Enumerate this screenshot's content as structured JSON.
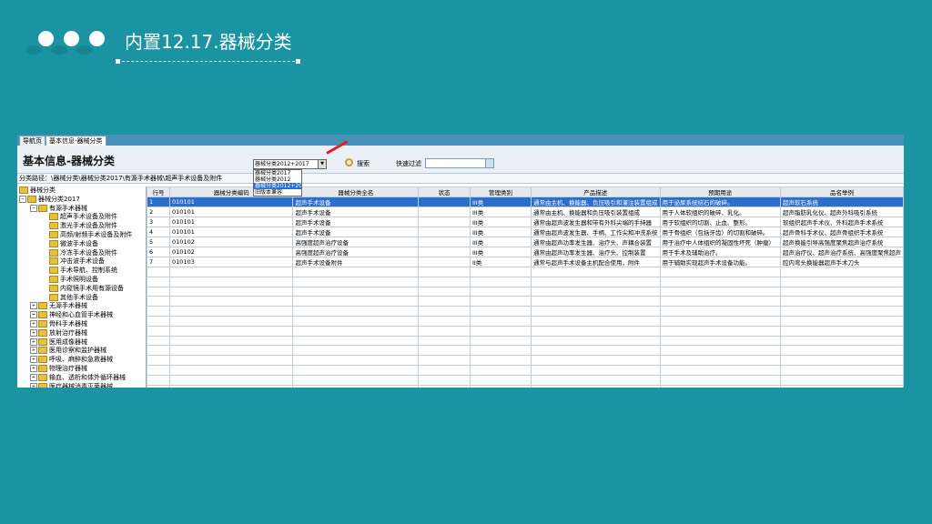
{
  "slide": {
    "title": "内置12.17.器械分类"
  },
  "app": {
    "tabs": [
      "导航页",
      "基本信息-器械分类"
    ],
    "header_title": "基本信息-器械分类",
    "select_value": "器械分类2012+2017",
    "dropdown_options": [
      "器械分类2017",
      "器械分类2012",
      "器械分类2012+2017",
      "旧版本兼容"
    ],
    "search_label": "搜索",
    "filter_label": "快速过滤",
    "path": "分类路径：\\器械分类\\器械分类2017\\有源手术器械\\超声手术设备及附件",
    "tree": [
      {
        "label": "器械分类",
        "level": 0,
        "exp": ""
      },
      {
        "label": "器械分类2017",
        "level": 0,
        "exp": "−"
      },
      {
        "label": "有源手术器械",
        "level": 1,
        "exp": "−"
      },
      {
        "label": "超声手术设备及附件",
        "level": 2,
        "exp": ""
      },
      {
        "label": "激光手术设备及附件",
        "level": 2,
        "exp": ""
      },
      {
        "label": "高频/射频手术设备及附件",
        "level": 2,
        "exp": ""
      },
      {
        "label": "微波手术设备",
        "level": 2,
        "exp": ""
      },
      {
        "label": "冷冻手术设备及附件",
        "level": 2,
        "exp": ""
      },
      {
        "label": "冲击波手术设备",
        "level": 2,
        "exp": ""
      },
      {
        "label": "手术导航、控制系统",
        "level": 2,
        "exp": ""
      },
      {
        "label": "手术照明设备",
        "level": 2,
        "exp": ""
      },
      {
        "label": "内窥镜手术用有源设备",
        "level": 2,
        "exp": ""
      },
      {
        "label": "其他手术设备",
        "level": 2,
        "exp": ""
      },
      {
        "label": "无源手术器械",
        "level": 1,
        "exp": "+"
      },
      {
        "label": "神经和心血管手术器械",
        "level": 1,
        "exp": "+"
      },
      {
        "label": "骨科手术器械",
        "level": 1,
        "exp": "+"
      },
      {
        "label": "放射治疗器械",
        "level": 1,
        "exp": "+"
      },
      {
        "label": "医用成像器械",
        "level": 1,
        "exp": "+"
      },
      {
        "label": "医用诊察和监护器械",
        "level": 1,
        "exp": "+"
      },
      {
        "label": "呼吸、麻醉和急救器械",
        "level": 1,
        "exp": "+"
      },
      {
        "label": "物理治疗器械",
        "level": 1,
        "exp": "+"
      },
      {
        "label": "输血、透析和体外循环器械",
        "level": 1,
        "exp": "+"
      },
      {
        "label": "医疗器械消毒灭菌器械",
        "level": 1,
        "exp": "+"
      }
    ],
    "columns": [
      "行号",
      "器械分类编码",
      "器械分类全名",
      "状态",
      "管理类别",
      "产品描述",
      "预期用途",
      "品名举例"
    ],
    "rows": [
      [
        "1",
        "010101",
        "超声手术设备",
        "",
        "III类",
        "通常由主机、换能器、负压吸引和灌注装置组成",
        "用于泌尿系统结石的破碎。",
        "超声软石系统"
      ],
      [
        "2",
        "010101",
        "超声手术设备",
        "",
        "III类",
        "通常由主机、换能器和负压吸引装置组成",
        "用于人体软组织的破碎、乳化。",
        "超声脂肪乳化仪、超声外科吸引系统"
      ],
      [
        "3",
        "010101",
        "超声手术设备",
        "",
        "III类",
        "通常由超声波发生器和带有外科尖端的手持器",
        "用于软组织的切割、止血、整形。",
        "软组织超声手术仪、外科超声手术系统"
      ],
      [
        "4",
        "010101",
        "超声手术设备",
        "",
        "III类",
        "通常由超声波发生器、手柄、工作尖和冲洗系统",
        "用于骨组织（包括牙齿）的切割和破碎。",
        "超声骨科手术仪、超声骨组织手术系统"
      ],
      [
        "5",
        "010102",
        "高强度超声治疗设备",
        "",
        "III类",
        "通常由超声功率发生器、治疗头、声耦合装置",
        "用于治疗中人体组织的凝固性坏死（肿瘤）",
        "超声换能引导高强度聚焦超声治疗系统"
      ],
      [
        "6",
        "010102",
        "高强度超声治疗设备",
        "",
        "III类",
        "通常由超声功率发生器、治疗头、控制装置",
        "用于手术及辅助治疗。",
        "超声治疗仪、超声治疗系统、高强度聚焦超声"
      ],
      [
        "7",
        "010103",
        "超声手术设备附件",
        "",
        "II类",
        "通常与超声手术设备主机配合使用，附件",
        "用于辅助实现超声手术设备功能。",
        "腔内弯头换能器超声手术刀头"
      ]
    ],
    "empty_rows": 14
  }
}
